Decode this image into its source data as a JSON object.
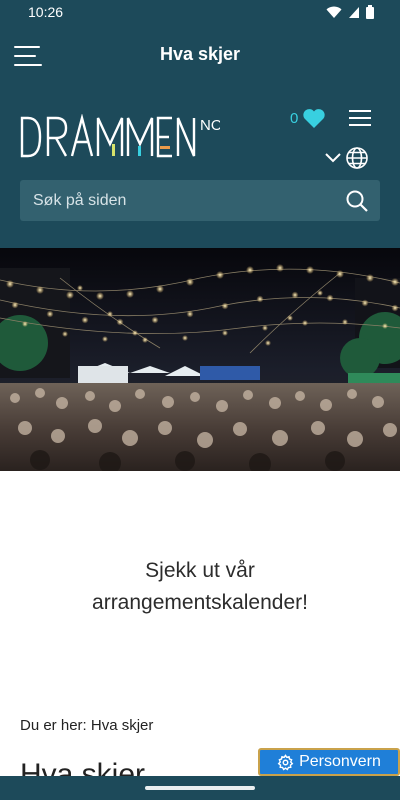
{
  "status_bar": {
    "time": "10:26"
  },
  "app_bar": {
    "title": "Hva skjer"
  },
  "site_header": {
    "logo_text": "DRAMMEN",
    "logo_suffix": "NO",
    "favorites_count": "0",
    "search": {
      "placeholder": "Søk på siden"
    }
  },
  "hero": {
    "image_alt": "Outdoor night festival crowd under string lights"
  },
  "promo": {
    "line1": "Sjekk ut vår",
    "line2": "arrangementskalender!"
  },
  "breadcrumb": {
    "prefix": "Du er her:",
    "current": "Hva skjer"
  },
  "page": {
    "title": "Hva skjer"
  },
  "privacy_button": {
    "label": "Personvern"
  },
  "colors": {
    "brand": "#1d4a5a",
    "accent": "#38d0e0",
    "privacy_blue": "#1f7fd8"
  }
}
